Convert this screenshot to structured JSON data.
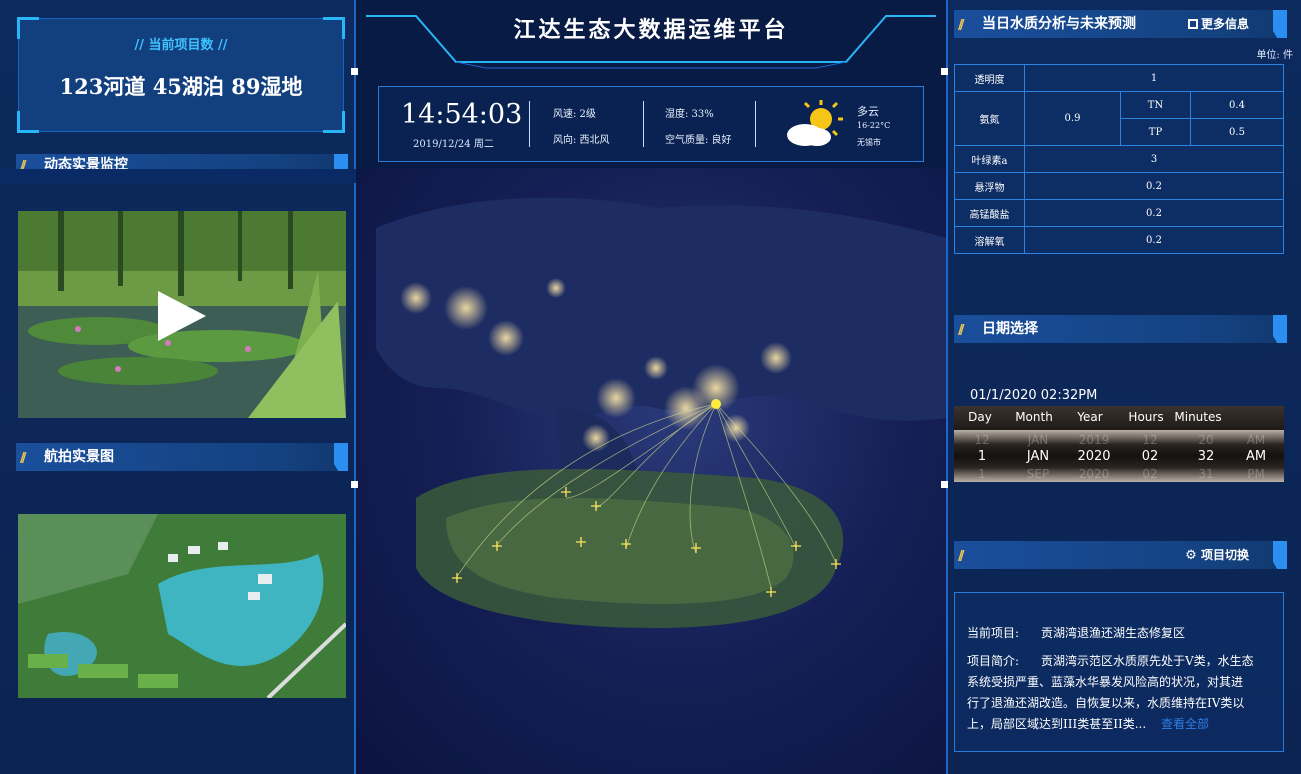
{
  "left": {
    "count": {
      "label": "//  当前项目数  //",
      "value": "123河道 45湖泊 89湿地"
    },
    "video_section_title": "动态实景监控",
    "aerial_section_title": "航拍实景图"
  },
  "center": {
    "title": "江达生态大数据运维平台",
    "weather": {
      "time": "14:54:03",
      "date": "2019/12/24  周二",
      "wind_speed": "风速: 2级",
      "wind_dir": "风向: 西北风",
      "humidity": "湿度: 33%",
      "air_quality": "空气质量: 良好",
      "condition": "多云",
      "temp_range": "16-22°C",
      "city": "无锡市",
      "icon": "partly-cloudy-icon"
    }
  },
  "right": {
    "wq_title": "当日水质分析与未来预测",
    "more_label": "更多信息",
    "unit": "单位: 件",
    "wq_rows": [
      {
        "name": "透明度",
        "value": "1"
      },
      {
        "name": "氨氮",
        "value": "0.9",
        "tn_label": "TN",
        "tn": "0.4",
        "tp_label": "TP",
        "tp": "0.5"
      },
      {
        "name": "叶绿素a",
        "value": "3"
      },
      {
        "name": "悬浮物",
        "value": "0.2"
      },
      {
        "name": "高锰酸盐",
        "value": "0.2"
      },
      {
        "name": "溶解氧",
        "value": "0.2"
      }
    ],
    "date_title": "日期选择",
    "date_picker": {
      "value": "01/1/2020 02:32PM",
      "headers": [
        "Day",
        "Month",
        "Year",
        "Hours",
        "Minutes",
        ""
      ],
      "prev": [
        "12",
        "JAN",
        "2019",
        "12",
        "20",
        "AM"
      ],
      "selected": [
        "1",
        "JAN",
        "2020",
        "02",
        "32",
        "AM"
      ],
      "next": [
        "1",
        "SEP",
        "2020",
        "02",
        "31",
        "PM"
      ]
    },
    "switch_label": "项目切换",
    "project": {
      "current_label": "当前项目:",
      "current_value": "贡湖湾退渔还湖生态修复区",
      "intro_label": "项目简介:",
      "intro_text_1": "贡湖湾示范区水质原先处于V类，水生态",
      "intro_text_2": "系统受损严重、蓝藻水华暴发风险高的状况，对其进",
      "intro_text_3": "行了退渔还湖改造。自恢复以来，水质维持在IV类以",
      "intro_text_4": "上，局部区域达到III类甚至II类...",
      "more_link": "查看全部"
    }
  },
  "colors": {
    "accent": "#29b6f6",
    "panel": "#12407e",
    "highlight": "#f2c94c"
  }
}
